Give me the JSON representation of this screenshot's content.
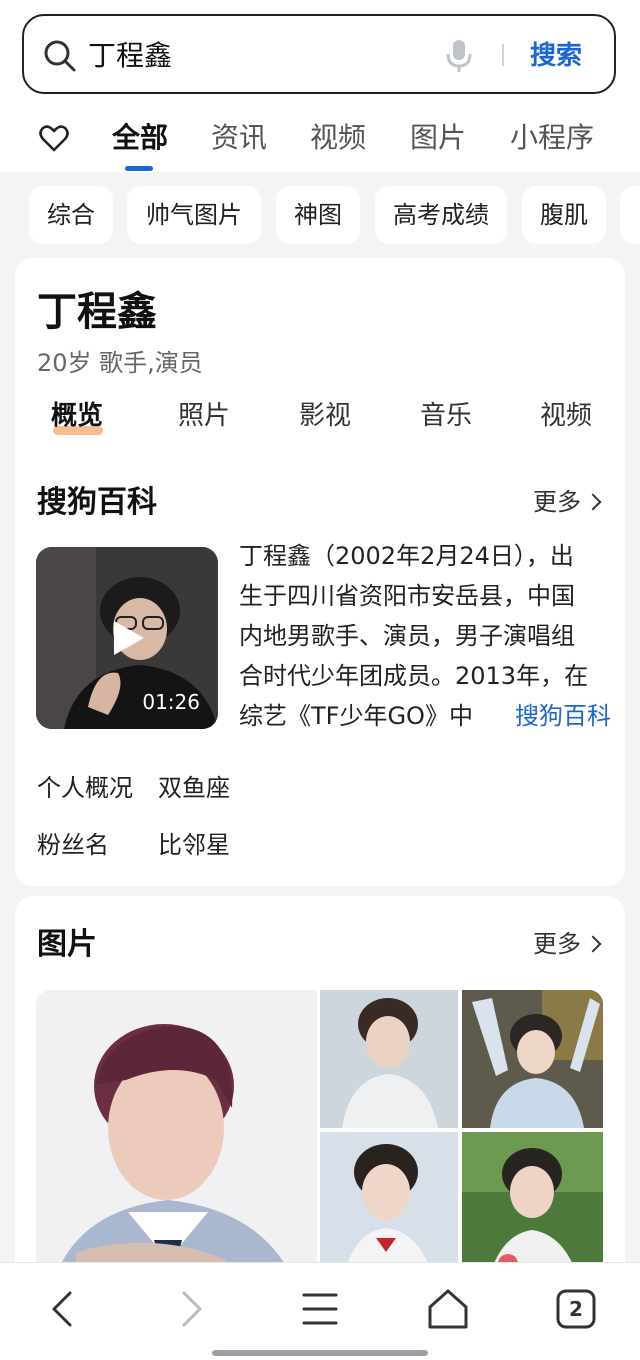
{
  "search": {
    "query": "丁程鑫",
    "button_label": "搜索"
  },
  "tabs": [
    {
      "label": "全部",
      "active": true
    },
    {
      "label": "资讯"
    },
    {
      "label": "视频"
    },
    {
      "label": "图片"
    },
    {
      "label": "小程序"
    }
  ],
  "chips": [
    "综合",
    "帅气图片",
    "神图",
    "高考成绩",
    "腹肌"
  ],
  "profile": {
    "name": "丁程鑫",
    "subtitle": "20岁 歌手,演员",
    "subtabs": [
      "概览",
      "照片",
      "影视",
      "音乐",
      "视频"
    ]
  },
  "baike": {
    "title": "搜狗百科",
    "more": "更多",
    "video_duration": "01:26",
    "bio_lines": [
      "丁程鑫（2002年2月24日），出",
      "生于四川省资阳市安岳县，中国",
      "内地男歌手、演员，男子演唱组",
      "合时代少年团成员。2013年，在",
      "综艺《TF少年GO》中"
    ],
    "source_link": "搜狗百科",
    "rows": [
      {
        "label": "个人概况",
        "value": "双鱼座"
      },
      {
        "label": "粉丝名",
        "value": "比邻星"
      }
    ]
  },
  "images": {
    "title": "图片",
    "more": "更多"
  },
  "bottom_nav": {
    "tab_count": "2"
  },
  "colors": {
    "accent": "#1a66d6",
    "underline": "#f7b27a",
    "background": "#f3f4f6"
  }
}
